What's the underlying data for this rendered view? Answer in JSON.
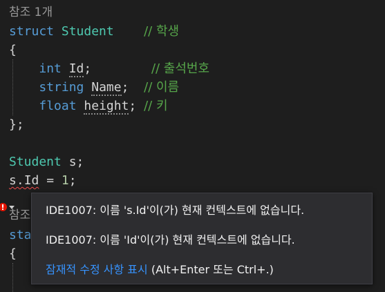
{
  "codelens": "참조 1개",
  "code": {
    "l1_kw": "struct",
    "l1_type": "Student",
    "l1_comment": "// 학생",
    "l2": "{",
    "l3_kw": "int",
    "l3_id": "Id",
    "l3_semi": ";",
    "l3_comment": "// 출석번호",
    "l4_kw": "string",
    "l4_id": "Name",
    "l4_semi": ";",
    "l4_comment": "// 이름",
    "l5_kw": "float",
    "l5_id": "height",
    "l5_semi": ";",
    "l5_comment": "// 키",
    "l6": "};",
    "l8_type": "Student",
    "l8_rest": " s;",
    "l9_obj": "s.",
    "l9_member": "Id",
    "l9_op": " = ",
    "l9_num": "1",
    "l9_semi": ";",
    "partial1": "참조",
    "partial2": "sta",
    "partial3": "{"
  },
  "tooltip": {
    "error1": "IDE1007: 이름 's.Id'이(가) 현재 컨텍스트에 없습니다.",
    "error2": "IDE1007: 이름 'Id'이(가) 현재 컨텍스트에 없습니다.",
    "fix_link": "잠재적 수정 사항 표시",
    "fix_shortcut": " (Alt+Enter 또는 Ctrl+.)"
  },
  "colors": {
    "background": "#1e1e1e",
    "keyword": "#569cd6",
    "type": "#4ec9b0",
    "comment": "#57a64a",
    "error": "#f14c4c",
    "link": "#3794ff"
  },
  "icons": {
    "lightbulb": "error-lightbulb-icon"
  }
}
